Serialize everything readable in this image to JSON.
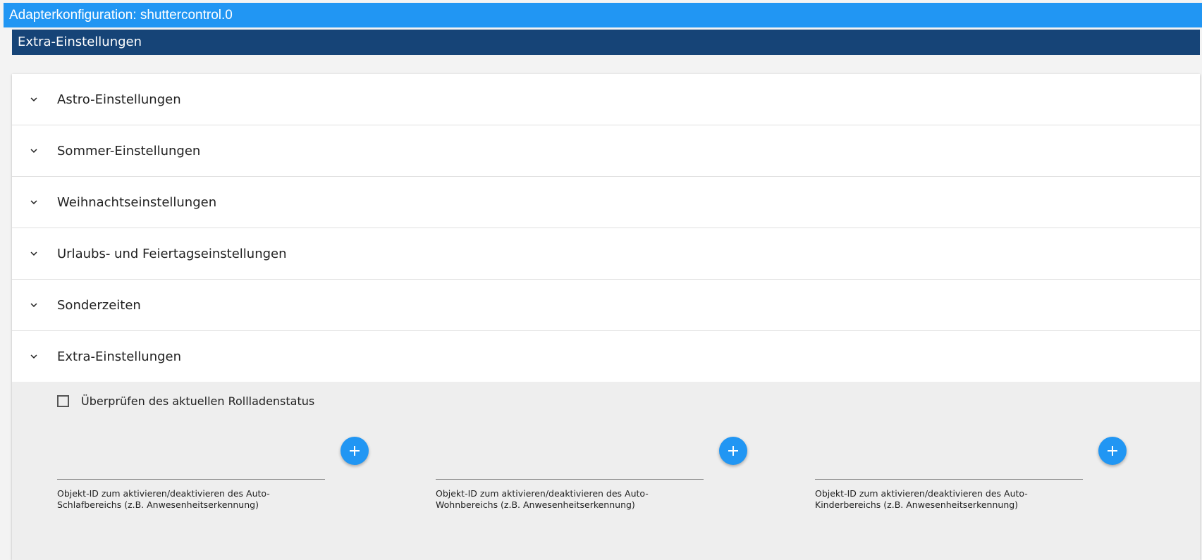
{
  "window": {
    "title": "Adapterkonfiguration: shuttercontrol.0"
  },
  "section": {
    "title": "Extra-Einstellungen"
  },
  "accordion": [
    {
      "label": "Astro-Einstellungen",
      "icon": "chevron-down-icon"
    },
    {
      "label": "Sommer-Einstellungen",
      "icon": "chevron-down-icon"
    },
    {
      "label": "Weihnachtseinstellungen",
      "icon": "chevron-down-icon"
    },
    {
      "label": "Urlaubs- und Feiertagseinstellungen",
      "icon": "chevron-down-icon"
    },
    {
      "label": "Sonderzeiten",
      "icon": "chevron-down-icon"
    },
    {
      "label": "Extra-Einstellungen",
      "icon": "chevron-down-icon"
    }
  ],
  "extra": {
    "checkbox_label": "Überprüfen des aktuellen Rollladenstatus",
    "checkbox_checked": false,
    "object_fields": [
      {
        "value": "",
        "help": "Objekt-ID zum aktivieren/deaktivieren des Auto-Schlafbereichs (z.B. Anwesenheitserkennung)"
      },
      {
        "value": "",
        "help": "Objekt-ID zum aktivieren/deaktivieren des Auto-Wohnbereichs (z.B. Anwesenheitserkennung)"
      },
      {
        "value": "",
        "help": "Objekt-ID zum aktivieren/deaktivieren des Auto-Kinderbereichs (z.B. Anwesenheitserkennung)"
      }
    ]
  },
  "colors": {
    "accent": "#2196f3",
    "section": "#164477",
    "body_bg": "#eeeeee"
  }
}
